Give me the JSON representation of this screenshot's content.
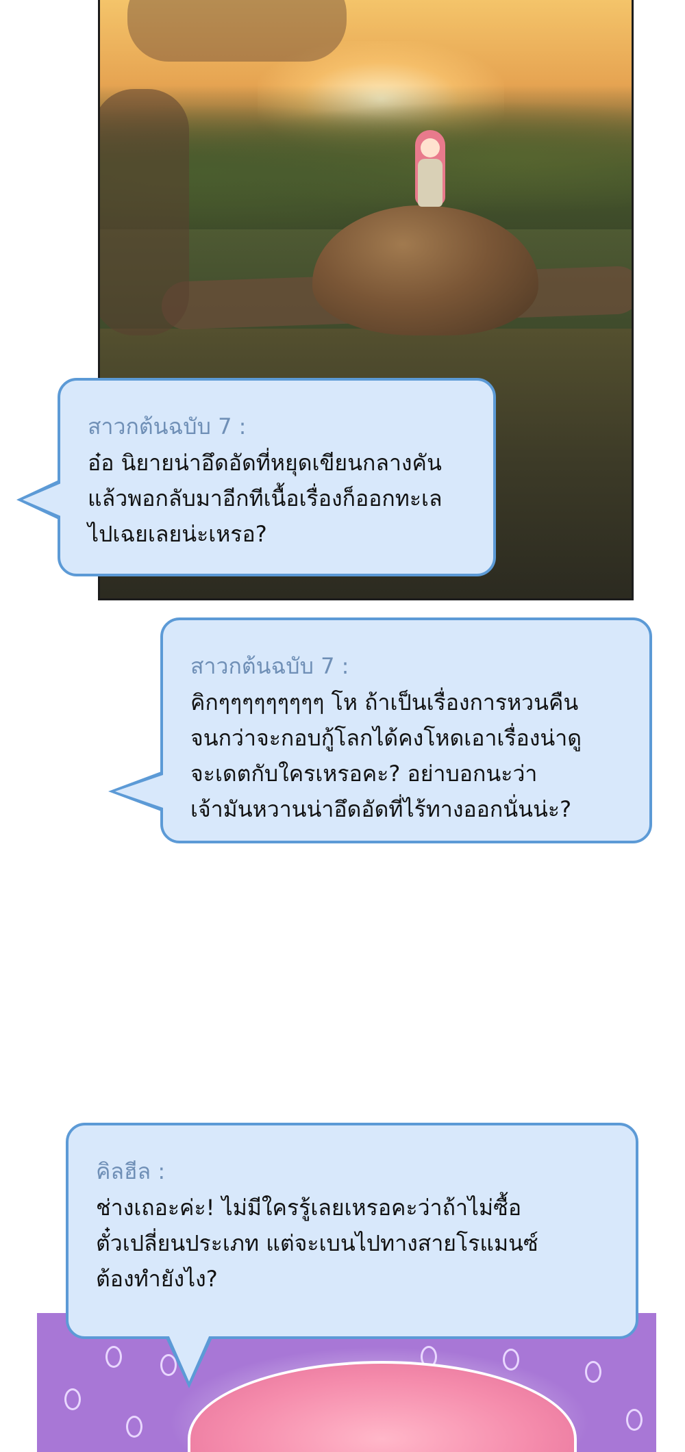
{
  "bubbles": [
    {
      "speaker": "สาวกต้นฉบับ 7 :",
      "lines": [
        "อ๋อ นิยายน่าอึดอัดที่หยุดเขียนกลางคัน",
        "แล้วพอกลับมาอีกทีเนื้อเรื่องก็ออกทะเล",
        "ไปเฉยเลยน่ะเหรอ?"
      ]
    },
    {
      "speaker": "สาวกต้นฉบับ 7 :",
      "lines": [
        "คิกๆๆๆๆๆๆๆๆๆ โห ถ้าเป็นเรื่องการหวนคืน",
        "จนกว่าจะกอบกู้โลกได้คงโหดเอาเรื่องน่าดู",
        "จะเดตกับใครเหรอคะ? อย่าบอกนะว่า",
        "เจ้ามันหวานน่าอึดอัดที่ไร้ทางออกนั่นน่ะ?"
      ]
    },
    {
      "speaker": "คิลฮีล :",
      "lines": [
        "ช่างเถอะค่ะ! ไม่มีใครรู้เลยเหรอคะว่าถ้าไม่ซื้อ",
        "ตั๋วเปลี่ยนประเภท แต่จะเบนไปทางสายโรแมนซ์",
        "ต้องทำยังไง?"
      ]
    }
  ],
  "colors": {
    "bubble_fill": "#d8e8fb",
    "bubble_border": "#5c9ad6",
    "speaker_text": "#6f8fb6",
    "body_text": "#111111",
    "purple_panel": "#a877d6"
  }
}
